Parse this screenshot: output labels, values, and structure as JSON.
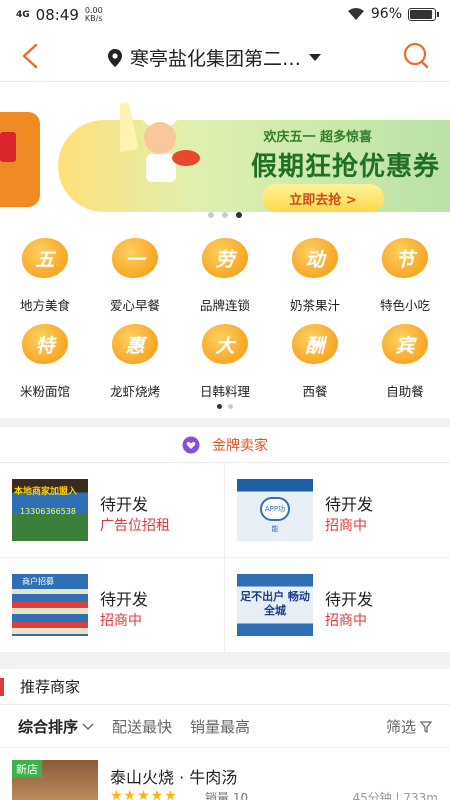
{
  "status": {
    "signal": "4G",
    "time": "08:49",
    "speed_value": "0.00",
    "speed_unit": "KB/s",
    "battery": "96%",
    "battery_level": 0.96
  },
  "header": {
    "location": "寒亭盐化集团第二…"
  },
  "banner": {
    "subtitle": "欢庆五一  超多惊喜",
    "title": "假期狂抢优惠券",
    "button": "立即去抢 >",
    "page_count": 3,
    "active_page": 2
  },
  "categories": [
    {
      "glyph": "五",
      "label": "地方美食"
    },
    {
      "glyph": "一",
      "label": "爱心早餐"
    },
    {
      "glyph": "劳",
      "label": "品牌连锁"
    },
    {
      "glyph": "动",
      "label": "奶茶果汁"
    },
    {
      "glyph": "节",
      "label": "特色小吃"
    },
    {
      "glyph": "特",
      "label": "米粉面馆"
    },
    {
      "glyph": "惠",
      "label": "龙虾烧烤"
    },
    {
      "glyph": "大",
      "label": "日韩料理"
    },
    {
      "glyph": "酬",
      "label": "西餐"
    },
    {
      "glyph": "宾",
      "label": "自助餐"
    }
  ],
  "gold": {
    "title": "金牌卖家",
    "items": [
      {
        "name": "待开发",
        "tag": "广告位招租",
        "img_text": "本地商家加盟入",
        "img_phone": "13306366538"
      },
      {
        "name": "待开发",
        "tag": "招商中",
        "img_text": "APP功能"
      },
      {
        "name": "待开发",
        "tag": "招商中",
        "img_text": "商户招募"
      },
      {
        "name": "待开发",
        "tag": "招商中",
        "img_text": "足不出户 畅动全城"
      }
    ]
  },
  "recommend": {
    "title": "推荐商家"
  },
  "sort": {
    "comprehensive": "综合排序",
    "fastest": "配送最快",
    "top_sales": "销量最高",
    "filter": "筛选"
  },
  "shop": {
    "badge": "新店",
    "name": "泰山火烧 · 牛肉汤",
    "stars": "★★★★★",
    "sales": "销量 10",
    "distance": "45分钟 | 733m"
  }
}
